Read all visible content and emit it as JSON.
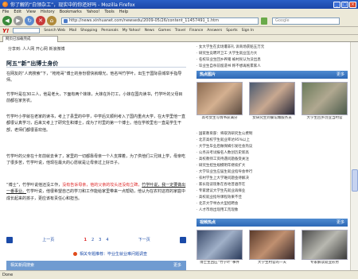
{
  "window": {
    "title": "你了解的“白领杂工”，现实中的你还好吗 - Mozilla Firefox",
    "buttons": [
      "_",
      "□",
      "×"
    ]
  },
  "menu": [
    "File",
    "Edit",
    "View",
    "History",
    "Bookmarks",
    "Yahoo!",
    "Tools",
    "Help"
  ],
  "nav": {
    "url": "http://news.xinhuanet.com/newsedu/2009-05/26/content_11457491_1.htm",
    "search_placeholder": "Google"
  },
  "yahoo_toolbar": {
    "logo": "Y!",
    "items": [
      "Search Web",
      "Mail",
      "Shopping",
      "Personals",
      "My Yahoo!",
      "News",
      "Games",
      "Travel",
      "Finance",
      "Answers",
      "Sports",
      "Sign In"
    ]
  },
  "tab": {
    "label": "网页已加载完成"
  },
  "article": {
    "share_label": "分享到: 人人网 开心网 新浪微博",
    "heading": "阿五“新”出博士身价",
    "p1": "在网友的“人肉搜索”下，“枪枪哥”博士的身份很快就曝光，他名叫竹学叶，出生于国际县城举手指导师。",
    "p2": "竹学叶是在30三人，他是老大，下面有两个妹妹，大妹在外打工，小妹在国内读书，竹学叶的父母目前都在家务农。",
    "p3": "竹学叶小学就在老家的读书，考上了县里的中学，中学后又顺利考入了国内重点大学，在大学里他一直都很认真学习，后来又考上了研究生和博士，成为了村里的第一个博士。他在学校里也一直是学生干部，老师们都很喜欢他。",
    "p4": "竹学叶的父亲在十年前就去世了，家里的一切都靠母亲一个人支撑着，为了供他们三兄妹上学，母亲吃了很多苦，竹学叶说，他现在最大的心愿就是让母亲过上好日子。",
    "p5_pre": "“博士”，竹学叶说他还没工作，",
    "p5_red": "没有告诉母亲，他的父亲的坟头还没有立碑，",
    "p5_mid": "竹学叶说，我一定要做出一番事业。",
    "p5_post": "竹学叶说，他很希望自己的学习和工作能给家里带来一点帮助，他认为在农村这样的家庭中成长起来的孩子，更应该有责任心和担当。",
    "pager": {
      "prev": "上一页",
      "pages": [
        "1",
        "2",
        "3",
        "4"
      ],
      "current": "1",
      "next": "下一页"
    },
    "related_label": "相关专题推荐：毕业生就业难问题调查",
    "bottom_bar": {
      "label": "相关新闻搜索",
      "more": "更多"
    }
  },
  "sidebar": {
    "top_links": [
      "女大学生在卖场遭非礼 诉商场获赔五万元",
      "研究生竞聘环卫工 大学生就业压力大",
      "名校毕业生回乡养猪 被村民认为没出息",
      "毕业生自杀前留遗书 称不想再拖累家人"
    ],
    "section1": {
      "title": "热点图片",
      "more": "更多"
    },
    "thumbs1": [
      {
        "caption": "高考女生写情书获满分"
      },
      {
        "caption": "女研究生到餐馆做服务员"
      },
      {
        "caption": "大学生回乡创业当村官"
      }
    ],
    "list_links": [
      "国家教育部：将取消研究生公费制",
      "北京高校学生就业率达95%以上",
      "大学生毕业后做保姆引发社会热议",
      "公务员考试报名人数创历史新高",
      "高校教师工资待遇问题备受关注",
      "研究生招生规模明年继续扩大",
      "大学毕业生应届生就业指导会举行",
      "农村学生上大学难问题亟待解决",
      "家长陪读现象在各地普遍存在",
      "专家建议大学生先就业再择业",
      "高校就业指导课程效果不佳",
      "北京大学举办大型招聘会",
      "人才市场出现用工荒现象"
    ],
    "section2": {
      "title": "视频热点",
      "more": "更多"
    },
    "thumbs2": [
      {
        "caption": "博士生回应“竹学叶”事件"
      },
      {
        "caption": "大学生村官的一天"
      },
      {
        "caption": "专家解读就业形势"
      }
    ]
  },
  "status": "Done",
  "colors": {
    "accent": "#2d68b6",
    "highlight_red": "#dd2222",
    "link": "#1a4aa8"
  }
}
